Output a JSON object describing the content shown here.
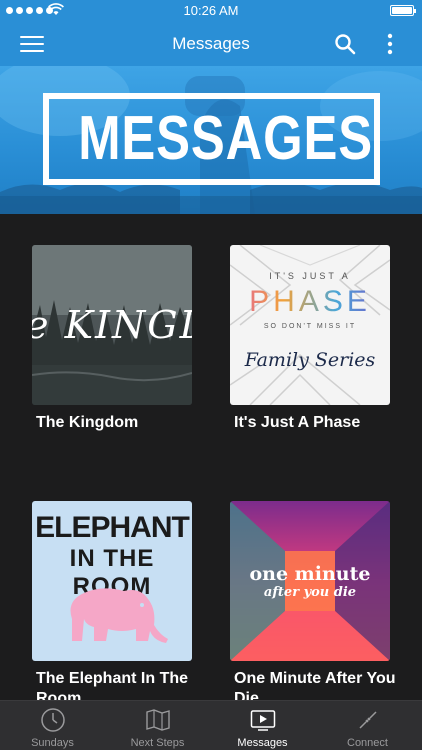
{
  "status_bar": {
    "time": "10:26 AM"
  },
  "nav": {
    "title": "Messages"
  },
  "hero": {
    "title": "MESSAGES"
  },
  "cards": [
    {
      "title": "The Kingdom",
      "art_text": "e KINGDO"
    },
    {
      "title": "It's Just A Phase",
      "art_top": "IT'S JUST A",
      "art_main": "PHASE",
      "art_sub": "SO DON'T MISS IT",
      "art_script": "Family Series"
    },
    {
      "title": "The Elephant In The Room",
      "art_line1": "ELEPHANT",
      "art_line2": "IN THE ROOM"
    },
    {
      "title": "One Minute After You Die",
      "art_line1": "one minute",
      "art_line2": "after you die"
    }
  ],
  "tabs": [
    {
      "label": "Sundays",
      "icon": "clock-icon"
    },
    {
      "label": "Next Steps",
      "icon": "map-icon"
    },
    {
      "label": "Messages",
      "icon": "play-screen-icon"
    },
    {
      "label": "Connect",
      "icon": "connect-icon"
    }
  ],
  "colors": {
    "accent": "#2a8fd6",
    "background": "#1c1c1d",
    "tab_bar": "#2f2f31"
  }
}
